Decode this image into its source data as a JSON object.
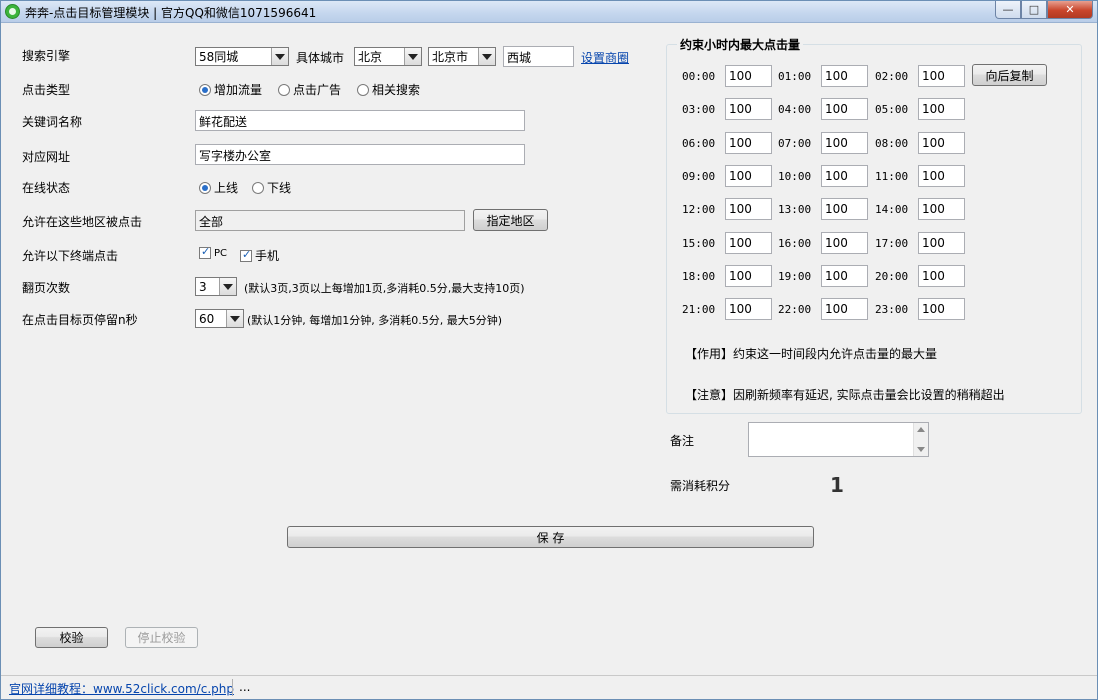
{
  "window": {
    "title": "奔奔-点击目标管理模块 | 官方QQ和微信1071596641",
    "controls": {
      "minimize": "—",
      "maximize": "□",
      "close": "✕"
    }
  },
  "form": {
    "search_engine": {
      "label": "搜索引擎",
      "value": "58同城"
    },
    "city": {
      "label": "具体城市",
      "province": "北京",
      "city": "北京市",
      "district": "西城",
      "map_link": "设置商圈"
    },
    "click_type": {
      "label": "点击类型",
      "options": [
        "增加流量",
        "点击广告",
        "相关搜索"
      ],
      "selected": 0
    },
    "keyword": {
      "label": "关键词名称",
      "value": "鲜花配送"
    },
    "url": {
      "label": "对应网址",
      "value": "写字楼办公室"
    },
    "online_status": {
      "label": "在线状态",
      "options": [
        "上线",
        "下线"
      ],
      "selected": 0
    },
    "regions": {
      "label": "允许在这些地区被点击",
      "value": "全部",
      "button": "指定地区"
    },
    "terminals": {
      "label": "允许以下终端点击",
      "options": [
        "PC",
        "手机"
      ],
      "checked": [
        true,
        true
      ]
    },
    "pages": {
      "label": "翻页次数",
      "value": "3",
      "hint": "(默认3页,3页以上每增加1页,多消耗0.5分,最大支持10页)"
    },
    "stay": {
      "label": "在点击目标页停留n秒",
      "value": "60",
      "hint": "(默认1分钟, 每增加1分钟, 多消耗0.5分, 最大5分钟)"
    }
  },
  "hourly": {
    "title": "约束小时内最大点击量",
    "copy_button": "向后复制",
    "hours": [
      {
        "label": "00:00",
        "value": "100"
      },
      {
        "label": "01:00",
        "value": "100"
      },
      {
        "label": "02:00",
        "value": "100"
      },
      {
        "label": "03:00",
        "value": "100"
      },
      {
        "label": "04:00",
        "value": "100"
      },
      {
        "label": "05:00",
        "value": "100"
      },
      {
        "label": "06:00",
        "value": "100"
      },
      {
        "label": "07:00",
        "value": "100"
      },
      {
        "label": "08:00",
        "value": "100"
      },
      {
        "label": "09:00",
        "value": "100"
      },
      {
        "label": "10:00",
        "value": "100"
      },
      {
        "label": "11:00",
        "value": "100"
      },
      {
        "label": "12:00",
        "value": "100"
      },
      {
        "label": "13:00",
        "value": "100"
      },
      {
        "label": "14:00",
        "value": "100"
      },
      {
        "label": "15:00",
        "value": "100"
      },
      {
        "label": "16:00",
        "value": "100"
      },
      {
        "label": "17:00",
        "value": "100"
      },
      {
        "label": "18:00",
        "value": "100"
      },
      {
        "label": "19:00",
        "value": "100"
      },
      {
        "label": "20:00",
        "value": "100"
      },
      {
        "label": "21:00",
        "value": "100"
      },
      {
        "label": "22:00",
        "value": "100"
      },
      {
        "label": "23:00",
        "value": "100"
      }
    ],
    "note_effect": "【作用】约束这一时间段内允许点击量的最大量",
    "note_warning": "【注意】因刷新频率有延迟, 实际点击量会比设置的稍稍超出"
  },
  "remark": {
    "label": "备注",
    "value": ""
  },
  "cost": {
    "label": "需消耗积分",
    "value": "1"
  },
  "buttons": {
    "save": "保 存",
    "verify": "校验",
    "stop_verify": "停止校验"
  },
  "statusbar": {
    "tutorial": "官网详细教程：www.52click.com/c.php",
    "extra": "..."
  }
}
